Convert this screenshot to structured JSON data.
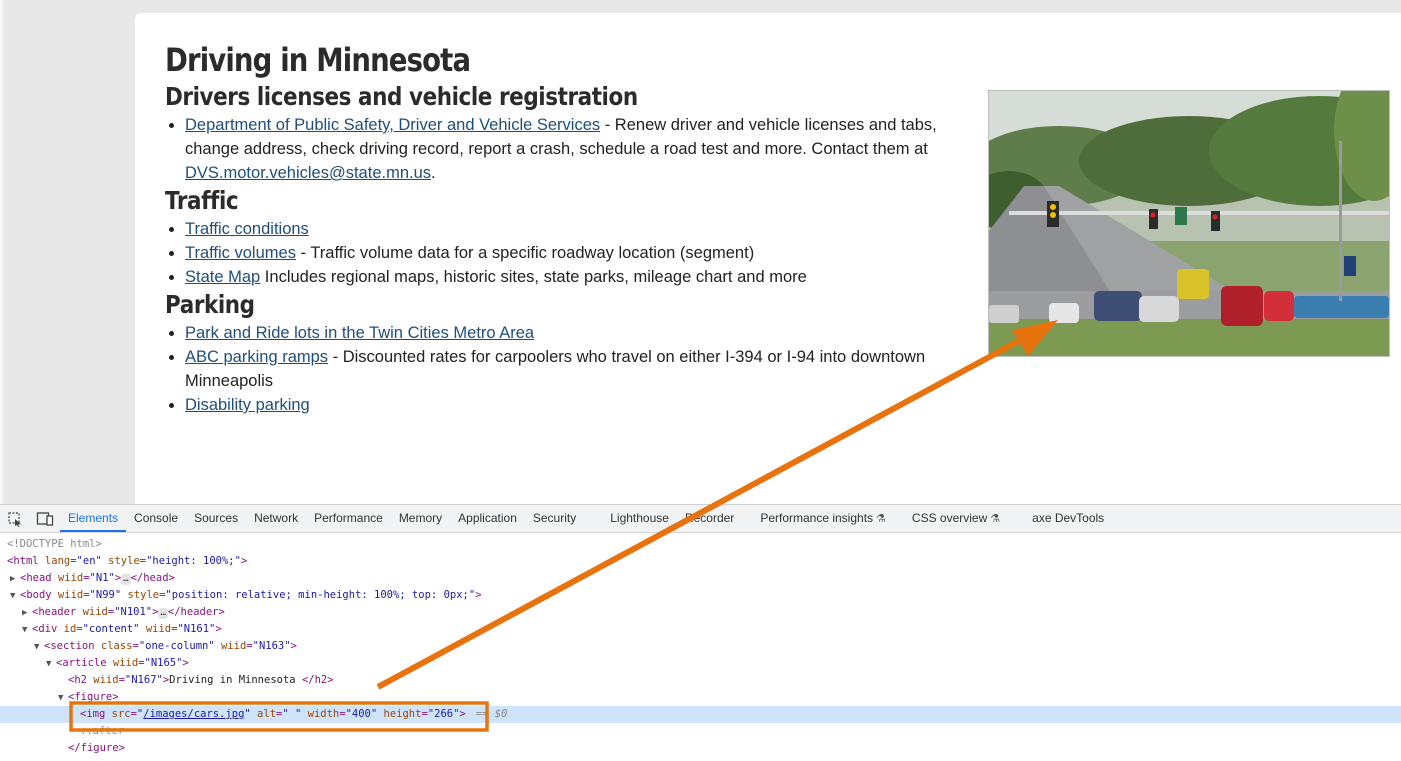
{
  "page": {
    "title": "Driving in Minnesota",
    "sections": [
      {
        "heading": "Drivers licenses and vehicle registration",
        "items": [
          {
            "link": "Department of Public Safety, Driver and Vehicle Services",
            "text": " - Renew driver and vehicle licenses and tabs, change address, check driving record, report a crash, schedule a road test and more. Contact them at ",
            "link2": "DVS.motor.vehicles@state.mn.us",
            "after": "."
          }
        ]
      },
      {
        "heading": "Traffic",
        "items": [
          {
            "link": "Traffic conditions",
            "text": ""
          },
          {
            "link": "Traffic volumes",
            "text": " - Traffic volume data for a specific roadway location (segment)"
          },
          {
            "link": "State Map",
            "text": " Includes regional maps, historic sites, state parks, mileage chart and more"
          }
        ]
      },
      {
        "heading": "Parking",
        "items": [
          {
            "link": "Park and Ride lots in the Twin Cities Metro Area",
            "text": ""
          },
          {
            "link": "ABC parking ramps",
            "text": " - Discounted rates for carpoolers who travel on either I-394 or I-94 into downtown Minneapolis"
          },
          {
            "link": "Disability parking",
            "text": ""
          }
        ]
      }
    ],
    "photo_icon": "traffic-road-photo"
  },
  "devtools": {
    "tabs": [
      "Elements",
      "Console",
      "Sources",
      "Network",
      "Performance",
      "Memory",
      "Application",
      "Security",
      "Lighthouse",
      "Recorder",
      "Performance insights",
      "CSS overview",
      "axe DevTools"
    ],
    "active_tab": "Elements",
    "inspect_icon": "inspect-element-icon",
    "device_icon": "device-toolbar-icon",
    "flask_icon": "experiment-flask-icon",
    "tree": {
      "doctype": "<!DOCTYPE html>",
      "html_open": "<html",
      "html_attr1": " lang",
      "html_val1": "\"en\"",
      "html_attr2": " style",
      "html_val2": "\"height: 100%;\"",
      "gt": ">",
      "head_open": "<head",
      "wiid": " wiid",
      "head_wiid": "\"N1\"",
      "head_close": "</head>",
      "body_open": "<body",
      "body_wiid": "\"N99\"",
      "body_style_attr": " style",
      "body_style": "\"position: relative; min-height: 100%; top: 0px;\"",
      "header_open": "<header",
      "header_wiid": "\"N101\"",
      "header_close": "</header>",
      "div_open": "<div",
      "div_id_attr": " id",
      "div_id": "\"content\"",
      "div_wiid": "\"N161\"",
      "section_open": "<section",
      "section_class_attr": " class",
      "section_class": "\"one-column\"",
      "section_wiid": "\"N163\"",
      "article_open": "<article",
      "article_wiid": "\"N165\"",
      "h2_open": "<h2",
      "h2_wiid": "\"N167\"",
      "h2_text": "Driving in Minnesota ",
      "h2_close": "</h2>",
      "figure_open": "<figure>",
      "img_open": "<img",
      "img_src_attr": " src",
      "img_src": "/images/cars.jpg",
      "img_alt_attr": " alt",
      "img_alt": "\" \"",
      "img_w_attr": " width",
      "img_w": "\"400\"",
      "img_h_attr": " height",
      "img_h": "\"266\"",
      "eq_dollar": "== $0",
      "after": "::after",
      "figure_close": "</figure>",
      "ellipsis": "…",
      "eq": "="
    }
  },
  "annotation": {
    "color": "#e8730d",
    "meaning": "arrow from highlighted img element to the photo"
  }
}
